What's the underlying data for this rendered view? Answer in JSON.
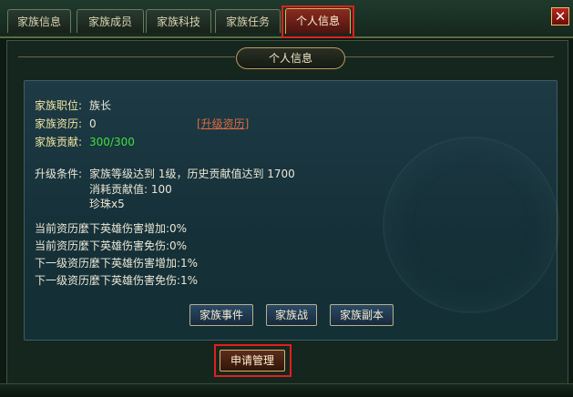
{
  "tabs": [
    {
      "label": "家族信息",
      "active": false
    },
    {
      "label": "家族成员",
      "active": false
    },
    {
      "label": "家族科技",
      "active": false
    },
    {
      "label": "家族任务",
      "active": false
    },
    {
      "label": "个人信息",
      "active": true
    }
  ],
  "close_label": "✕",
  "section_title": "个人信息",
  "info": {
    "position_label": "家族职位:",
    "position_value": "族长",
    "qualification_label": "家族资历:",
    "qualification_value": "0",
    "upgrade_link": "[升级资历]",
    "contribution_label": "家族贡献:",
    "contribution_value": "300/300"
  },
  "upgrade": {
    "label": "升级条件:",
    "line1": "家族等级达到 1级，历史贡献值达到 1700",
    "line2": "消耗贡献值: 100",
    "line3": "珍珠x5"
  },
  "stats": [
    "当前资历麼下英雄伤害增加:0%",
    "当前资历麼下英雄伤害免伤:0%",
    "下一级资历麼下英雄伤害增加:1%",
    "下一级资历麼下英雄伤害免伤:1%"
  ],
  "buttons": {
    "events": "家族事件",
    "war": "家族战",
    "dungeon": "家族副本",
    "apply": "申请管理"
  },
  "colors": {
    "accent_red": "#e0201c",
    "label_yellow": "#f0e4a0",
    "value_green": "#3fe03a",
    "link_orange": "#e06a40"
  }
}
